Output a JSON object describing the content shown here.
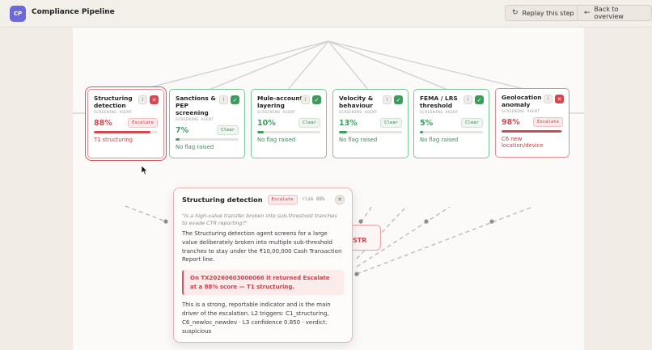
{
  "header": {
    "logo": "CP",
    "title": "Compliance Pipeline",
    "replay_label": "Replay this step",
    "back_label": "Back to overview"
  },
  "cards": [
    {
      "name": "Structuring detection",
      "agent": "SCREENING AGENT",
      "score": "88%",
      "score_value": 0.88,
      "verdict": "Escalate",
      "note": "T1 structuring",
      "status": "escalate"
    },
    {
      "name": "Sanctions & PEP screening",
      "agent": "SCREENING AGENT",
      "score": "7%",
      "score_value": 0.07,
      "verdict": "Clear",
      "note": "No flag raised",
      "status": "clear"
    },
    {
      "name": "Mule-account layering",
      "agent": "SCREENING AGENT",
      "score": "10%",
      "score_value": 0.1,
      "verdict": "Clear",
      "note": "No flag raised",
      "status": "clear"
    },
    {
      "name": "Velocity & behaviour",
      "agent": "SCREENING AGENT",
      "score": "13%",
      "score_value": 0.13,
      "verdict": "Clear",
      "note": "No flag raised",
      "status": "clear"
    },
    {
      "name": "FEMA / LRS threshold",
      "agent": "SCREENING AGENT",
      "score": "5%",
      "score_value": 0.05,
      "verdict": "Clear",
      "note": "No flag raised",
      "status": "clear"
    },
    {
      "name": "Geolocation anomaly",
      "agent": "SCREENING AGENT",
      "score": "98%",
      "score_value": 0.98,
      "verdict": "Escalate",
      "note": "C6 new location/device",
      "status": "escalate"
    }
  ],
  "info_label": "i",
  "str_node": {
    "label": "STR"
  },
  "popover": {
    "title": "Structuring detection",
    "badge": "Escalate",
    "risk": "risk 88%",
    "question": "\"Is a high-value transfer broken into sub-threshold tranches to evade CTR reporting?\"",
    "body": "The Structuring detection agent screens for a large value deliberately broken into multiple sub-threshold tranches to stay under the ₹10,00,000 Cash Transaction Report line.",
    "callout": "On TX20260603000066 it returned Escalate at a 88% score — T1 structuring.",
    "body2": "This is a strong, reportable indicator and is the main driver of the escalation. L2 triggers: C1_structuring, C6_newloc_newdev · L3 confidence 0.850 · verdict: suspicious"
  },
  "colors": {
    "accent": "#6c6ad8",
    "clear": "#3e9d5e",
    "escalate": "#d04952"
  }
}
